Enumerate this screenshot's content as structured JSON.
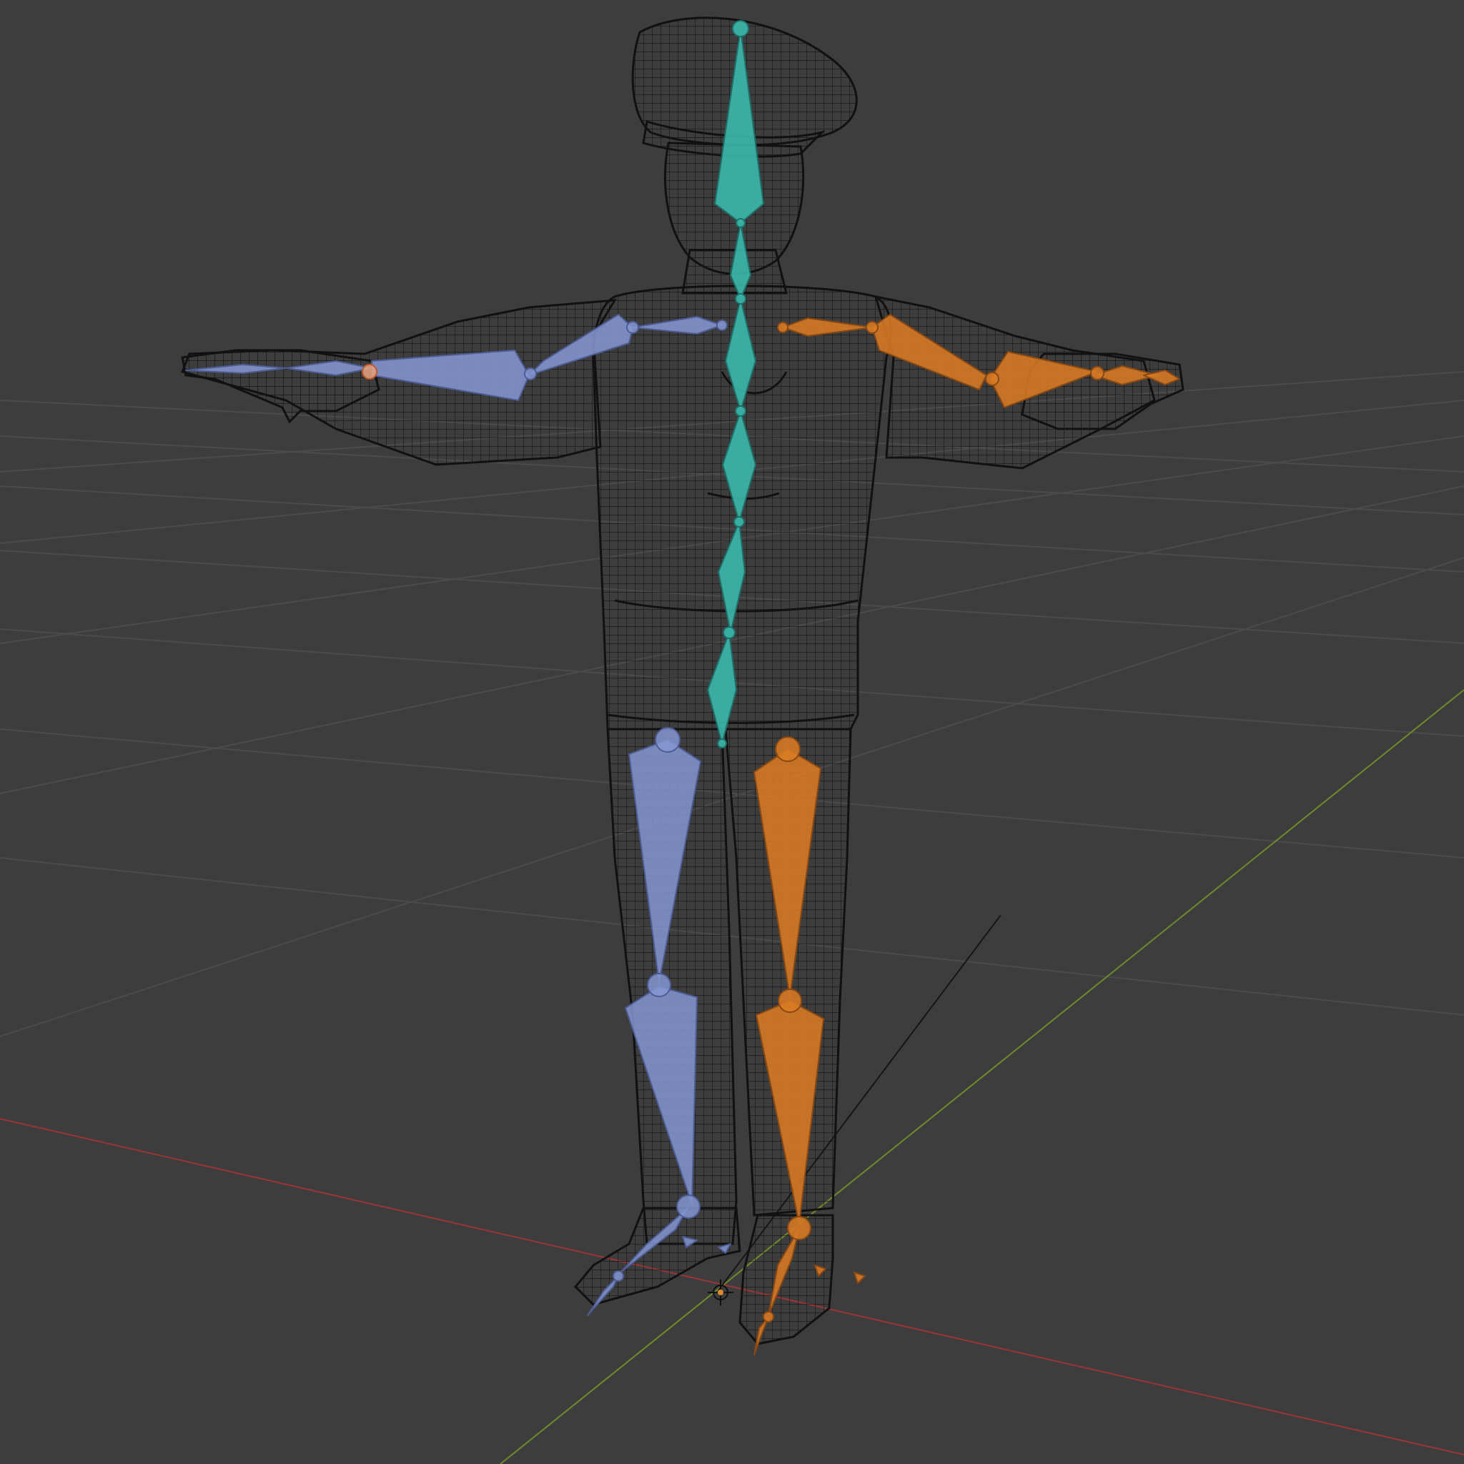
{
  "viewport": {
    "background": "#3d3d3d",
    "grid_color": "#4a4a4a",
    "x_axis_color": "#a33a3a",
    "y_axis_color": "#6f8a2a"
  },
  "mesh": {
    "wire_color": "#111111",
    "fill_color": "#2f2f2f"
  },
  "armature": {
    "center_color": "#3bb3a8",
    "left_color": "#8395d1",
    "right_color": "#d87a24"
  },
  "icons": {
    "origin": "3d-cursor-icon"
  }
}
